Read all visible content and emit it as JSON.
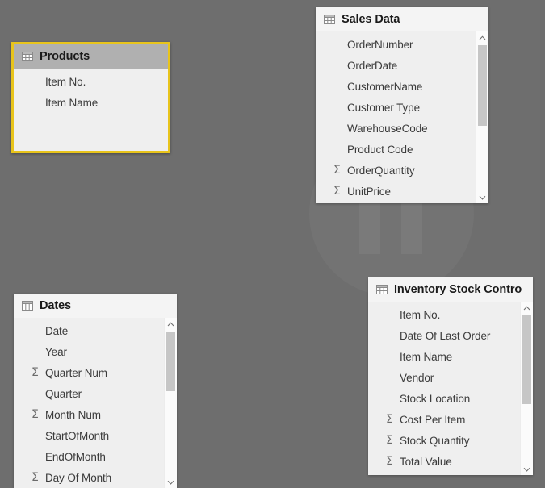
{
  "canvas": {
    "background_color": "#6e6e6e",
    "watermark_name": "pause-logo-watermark"
  },
  "tables": [
    {
      "id": "products",
      "title": "Products",
      "selected": true,
      "selection_color": "#e8c41b",
      "header_color": "#b0b0b0",
      "body_color": "#efefef",
      "has_scrollbar": false,
      "fields": [
        {
          "name": "Item No.",
          "numeric": false
        },
        {
          "name": "Item Name",
          "numeric": false
        }
      ]
    },
    {
      "id": "sales_data",
      "title": "Sales Data",
      "selected": false,
      "header_color": "#f4f4f4",
      "body_color": "#efefef",
      "has_scrollbar": true,
      "fields": [
        {
          "name": "OrderNumber",
          "numeric": false
        },
        {
          "name": "OrderDate",
          "numeric": false
        },
        {
          "name": "CustomerName",
          "numeric": false
        },
        {
          "name": "Customer Type",
          "numeric": false
        },
        {
          "name": "WarehouseCode",
          "numeric": false
        },
        {
          "name": "Product Code",
          "numeric": false
        },
        {
          "name": "OrderQuantity",
          "numeric": true
        },
        {
          "name": "UnitPrice",
          "numeric": true
        }
      ]
    },
    {
      "id": "dates",
      "title": "Dates",
      "selected": false,
      "header_color": "#f4f4f4",
      "body_color": "#efefef",
      "has_scrollbar": true,
      "fields": [
        {
          "name": "Date",
          "numeric": false
        },
        {
          "name": "Year",
          "numeric": false
        },
        {
          "name": "Quarter Num",
          "numeric": true
        },
        {
          "name": "Quarter",
          "numeric": false
        },
        {
          "name": "Month Num",
          "numeric": true
        },
        {
          "name": "StartOfMonth",
          "numeric": false
        },
        {
          "name": "EndOfMonth",
          "numeric": false
        },
        {
          "name": "Day Of Month",
          "numeric": true
        }
      ]
    },
    {
      "id": "inventory_stock_control",
      "title": "Inventory Stock Contro",
      "selected": false,
      "header_color": "#f4f4f4",
      "body_color": "#efefef",
      "has_scrollbar": true,
      "fields": [
        {
          "name": "Item No.",
          "numeric": false
        },
        {
          "name": "Date Of Last Order",
          "numeric": false
        },
        {
          "name": "Item Name",
          "numeric": false
        },
        {
          "name": "Vendor",
          "numeric": false
        },
        {
          "name": "Stock Location",
          "numeric": false
        },
        {
          "name": "Cost Per Item",
          "numeric": true
        },
        {
          "name": "Stock Quantity",
          "numeric": true
        },
        {
          "name": "Total Value",
          "numeric": true
        }
      ]
    }
  ],
  "icons": {
    "table": "table-grid-icon",
    "numeric_field": "sigma-icon",
    "scroll_up": "chevron-up-icon",
    "scroll_down": "chevron-down-icon"
  }
}
